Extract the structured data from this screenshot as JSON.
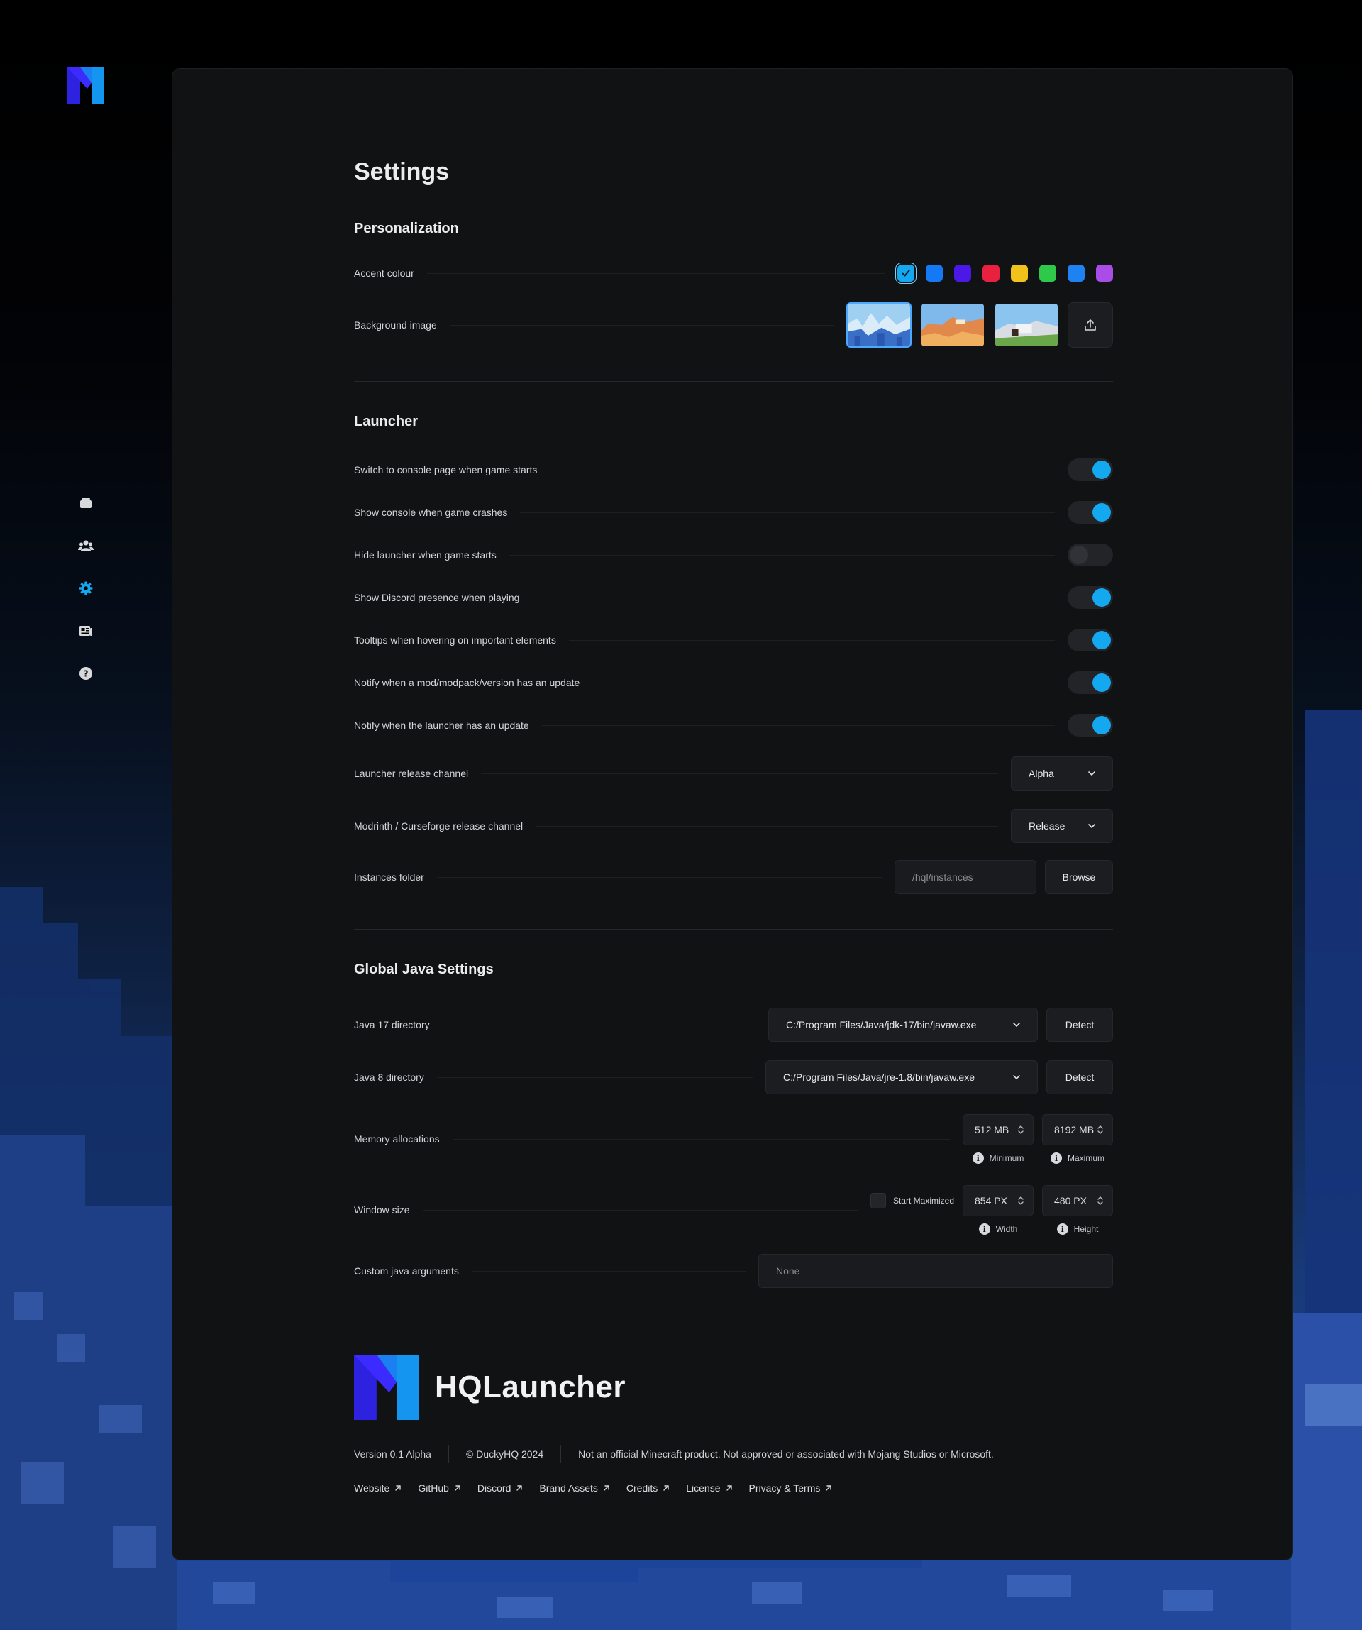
{
  "page": {
    "title": "Settings"
  },
  "sidebar": {
    "items": [
      {
        "icon": "instances-icon"
      },
      {
        "icon": "users-icon"
      },
      {
        "icon": "gear-icon",
        "active": true
      },
      {
        "icon": "news-icon"
      },
      {
        "icon": "help-icon"
      }
    ],
    "active_color": "#14a8f0"
  },
  "personalization": {
    "title": "Personalization",
    "accent_label": "Accent colour",
    "accent_colors": [
      "#14a8f0",
      "#1479f5",
      "#4a19e8",
      "#e8213e",
      "#f1c21b",
      "#2ec84a",
      "#1f82f2",
      "#a94ce8"
    ],
    "accent_selected_index": 0,
    "background_label": "Background image",
    "background_selected_index": 0
  },
  "launcher": {
    "title": "Launcher",
    "toggles": [
      {
        "label": "Switch to console page when game starts",
        "on": true
      },
      {
        "label": "Show console when game crashes",
        "on": true
      },
      {
        "label": "Hide launcher when game starts",
        "on": false
      },
      {
        "label": "Show Discord presence when playing",
        "on": true
      },
      {
        "label": "Tooltips when hovering on important elements",
        "on": true
      },
      {
        "label": "Notify when a mod/modpack/version has an update",
        "on": true
      },
      {
        "label": "Notify when the launcher has an update",
        "on": true
      }
    ],
    "release_channel_label": "Launcher release channel",
    "release_channel_value": "Alpha",
    "modrinth_channel_label": "Modrinth / Curseforge release channel",
    "modrinth_channel_value": "Release",
    "instances_label": "Instances folder",
    "instances_placeholder": "/hql/instances",
    "browse_label": "Browse"
  },
  "java": {
    "title": "Global Java Settings",
    "java17_label": "Java 17 directory",
    "java17_value": "C:/Program Files/Java/jdk-17/bin/javaw.exe",
    "java8_label": "Java 8 directory",
    "java8_value": "C:/Program Files/Java/jre-1.8/bin/javaw.exe",
    "detect_label": "Detect",
    "memory_label": "Memory allocations",
    "memory_min": "512 MB",
    "memory_min_hint": "Minimum",
    "memory_max": "8192 MB",
    "memory_max_hint": "Maximum",
    "window_label": "Window size",
    "start_maximized_label": "Start Maximized",
    "width_value": "854 PX",
    "width_hint": "Width",
    "height_value": "480 PX",
    "height_hint": "Height",
    "args_label": "Custom java arguments",
    "args_placeholder": "None"
  },
  "footer": {
    "brand": "HQLauncher",
    "version": "Version 0.1 Alpha",
    "copyright": "© DuckyHQ 2024",
    "disclaimer": "Not an official Minecraft product. Not approved or associated with Mojang Studios or Microsoft.",
    "links": [
      "Website",
      "GitHub",
      "Discord",
      "Brand Assets",
      "Credits",
      "License",
      "Privacy & Terms"
    ]
  }
}
